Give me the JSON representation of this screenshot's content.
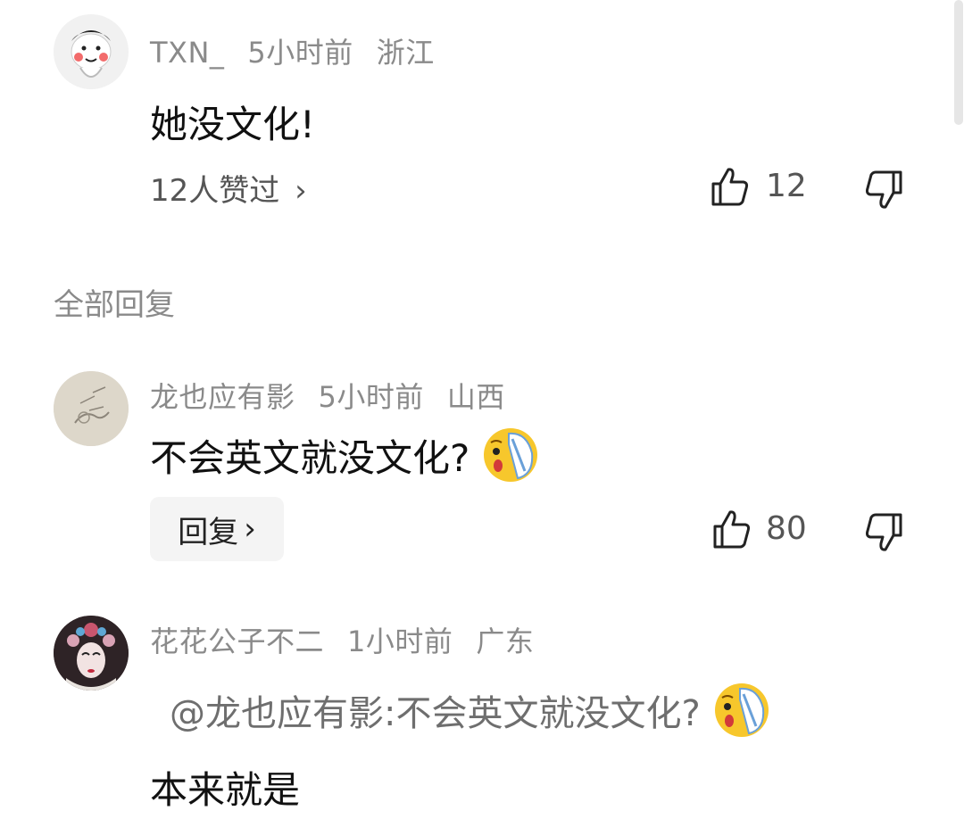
{
  "comment": {
    "username": "TXN_",
    "time": "5小时前",
    "location": "浙江",
    "text": "她没文化!",
    "likers_text": "12人赞过",
    "likers_chevron": "›",
    "like_count": "12",
    "icons": [
      "thumbs-up-icon",
      "thumbs-down-icon",
      "chevron-right-icon"
    ]
  },
  "replies_header": "全部回复",
  "replies": [
    {
      "username": "龙也应有影",
      "time": "5小时前",
      "location": "山西",
      "text": "不会英文就没文化?",
      "emoji": "crying-face-emoji",
      "reply_label": "回复",
      "reply_chevron": "›",
      "like_count": "80"
    },
    {
      "username": "花花公子不二",
      "time": "1小时前",
      "location": "广东",
      "quote": "@龙也应有影:不会英文就没文化?",
      "quote_emoji": "crying-face-emoji",
      "text": "本来就是"
    }
  ],
  "colors": {
    "meta": "#8a8a8a",
    "text": "#111111",
    "reply_bg": "#f4f4f4",
    "scrollbar": "#e6e6e6"
  }
}
